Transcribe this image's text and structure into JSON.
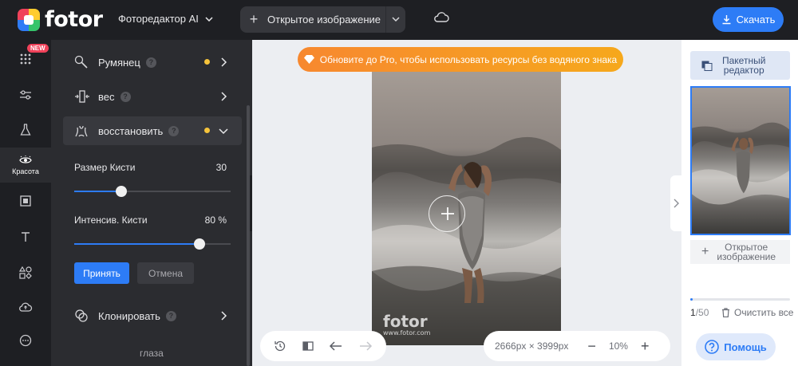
{
  "header": {
    "logo_text": "fotor",
    "ai_menu_label": "Фоторедактор AI",
    "open_image_label": "Открытое изображение",
    "download_label": "Скачать"
  },
  "rail": {
    "new_badge": "NEW",
    "active_label": "Красота"
  },
  "panel": {
    "blush_label": "Румянец",
    "weight_label": "вес",
    "restore_label": "восстановить",
    "brush_size_label": "Размер Кисти",
    "brush_size_value": "30",
    "brush_size_fraction": 0.3,
    "brush_intensity_label": "Интенсив. Кисти",
    "brush_intensity_value": "80 %",
    "brush_intensity_fraction": 0.8,
    "apply_label": "Принять",
    "cancel_label": "Отмена",
    "clone_label": "Клонировать",
    "eyes_label": "глаза",
    "help_glyph": "?"
  },
  "canvas": {
    "promo_text": "Обновите до Pro, чтобы использовать ресурсы без водяного знака",
    "watermark": "fotor",
    "watermark_sub": "www.fotor.com",
    "dimensions": "2666px × 3999px",
    "zoom": "10%"
  },
  "right_panel": {
    "batch_label_1": "Пакетный",
    "batch_label_2": "редактор",
    "open_label_1": "Открытое",
    "open_label_2": "изображение",
    "count_current": "1",
    "count_total": "/50",
    "clear_label": "Очистить все",
    "help_label": "Помощь"
  },
  "colors": {
    "accent": "#2d7cf6",
    "promo_start": "#f7882f",
    "promo_end": "#f6a81c",
    "dot": "#f5c33b"
  }
}
